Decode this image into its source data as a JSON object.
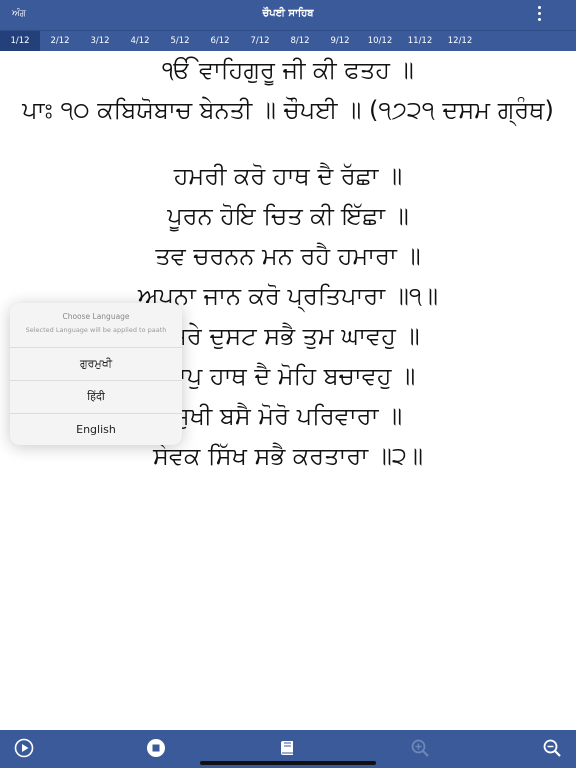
{
  "topbar": {
    "back_label": "ਅੰਗ",
    "title": "ਚੌਪਈ ਸਾਹਿਬ",
    "menu_icon": "more-vertical-icon"
  },
  "tabs": [
    {
      "label": "1/12",
      "active": true
    },
    {
      "label": "2/12",
      "active": false
    },
    {
      "label": "3/12",
      "active": false
    },
    {
      "label": "4/12",
      "active": false
    },
    {
      "label": "5/12",
      "active": false
    },
    {
      "label": "6/12",
      "active": false
    },
    {
      "label": "7/12",
      "active": false
    },
    {
      "label": "8/12",
      "active": false
    },
    {
      "label": "9/12",
      "active": false
    },
    {
      "label": "10/12",
      "active": false
    },
    {
      "label": "11/12",
      "active": false
    },
    {
      "label": "12/12",
      "active": false
    }
  ],
  "content": {
    "lines": [
      "ੴ ਵਾਹਿਗੁਰੂ ਜੀ ਕੀ ਫਤਹ ॥",
      "ਪਾਃ ੧੦ ਕਬਿਯੋਬਾਚ ਬੇਨਤੀ ॥ ਚੌਪਈ ॥ (੧੭੨੧ ਦਸਮ ਗ੍ਰੰਥ)",
      "",
      "ਹਮਰੀ ਕਰੋ ਹਾਥ ਦੈ ਰੱਛਾ ॥",
      "ਪੂਰਨ ਹੋਇ ਚਿਤ ਕੀ ਇੱਛਾ ॥",
      "ਤਵ ਚਰਨਨ ਮਨ ਰਹੈ ਹਮਾਰਾ ॥",
      "ਅਪਨਾ ਜਾਨ ਕਰੋ ਪ੍ਰਤਿਪਾਰਾ ॥੧॥",
      "ਹਮਰੇ ਦੁਸਟ ਸਭੈ ਤੁਮ ਘਾਵਹੁ ॥",
      "ਆਪੁ ਹਾਥ ਦੈ ਮੋਹਿ ਬਚਾਵਹੁ ॥",
      "ਸੁਖੀ ਬਸੈ ਮੋਰੋ ਪਰਿਵਾਰਾ ॥",
      "ਸੇਵਕ ਸਿੱਖ ਸਭੈ ਕਰਤਾਰਾ ॥੨॥"
    ]
  },
  "language_popup": {
    "title": "Choose Language",
    "subtitle": "Selected Language will be applied to paath",
    "options": [
      "ਗੁਰਮੁਖੀ",
      "हिंदी",
      "English"
    ]
  },
  "bottombar": {
    "icons": [
      "play-circle-icon",
      "stop-circle-icon",
      "book-icon",
      "zoom-in-icon",
      "zoom-out-icon"
    ]
  },
  "colors": {
    "bar": "#3a5a9a",
    "active_tab": "#24407a",
    "disabled_icon": "#6f86b8"
  }
}
